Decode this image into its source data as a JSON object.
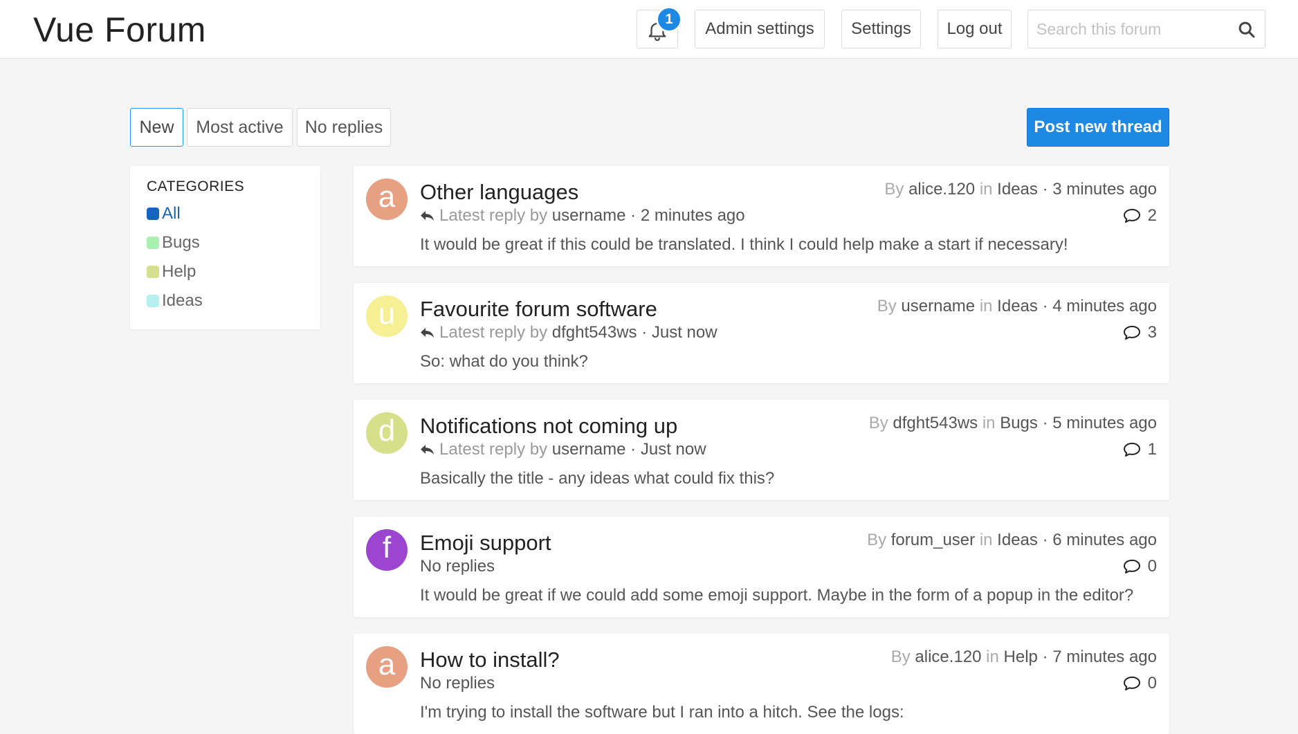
{
  "header": {
    "logo": "Vue Forum",
    "notification_count": "1",
    "admin_label": "Admin settings",
    "settings_label": "Settings",
    "logout_label": "Log out",
    "search_placeholder": "Search this forum"
  },
  "tabs": [
    "New",
    "Most active",
    "No replies"
  ],
  "active_tab": "New",
  "post_button": "Post new thread",
  "categories": {
    "title": "CATEGORIES",
    "items": [
      {
        "label": "All",
        "color": "#1565c0",
        "active": true
      },
      {
        "label": "Bugs",
        "color": "#a8efb0",
        "active": false
      },
      {
        "label": "Help",
        "color": "#d4df8f",
        "active": false
      },
      {
        "label": "Ideas",
        "color": "#b5f0ee",
        "active": false
      }
    ]
  },
  "labels": {
    "by": "By",
    "in": "in",
    "latest_reply_by": "Latest reply by",
    "sep": "·"
  },
  "threads": [
    {
      "avatar_letter": "a",
      "avatar_color": "#e8a083",
      "title": "Other languages",
      "reply_user": "username",
      "reply_time": "2 minutes ago",
      "no_replies": "",
      "snippet": "It would be great if this could be translated. I think I could help make a start if necessary!",
      "author": "alice.120",
      "category": "Ideas",
      "time": "3 minutes ago",
      "count": "2"
    },
    {
      "avatar_letter": "u",
      "avatar_color": "#f7ef94",
      "title": "Favourite forum software",
      "reply_user": "dfght543ws",
      "reply_time": "Just now",
      "no_replies": "",
      "snippet": "So: what do you think?",
      "author": "username",
      "category": "Ideas",
      "time": "4 minutes ago",
      "count": "3"
    },
    {
      "avatar_letter": "d",
      "avatar_color": "#d6e08a",
      "title": "Notifications not coming up",
      "reply_user": "username",
      "reply_time": "Just now",
      "no_replies": "",
      "snippet": "Basically the title - any ideas what could fix this?",
      "author": "dfght543ws",
      "category": "Bugs",
      "time": "5 minutes ago",
      "count": "1"
    },
    {
      "avatar_letter": "f",
      "avatar_color": "#9b45d0",
      "title": "Emoji support",
      "reply_user": "",
      "reply_time": "",
      "no_replies": "No replies",
      "snippet": "It would be great if we could add some emoji support. Maybe in the form of a popup in the editor?",
      "author": "forum_user",
      "category": "Ideas",
      "time": "6 minutes ago",
      "count": "0"
    },
    {
      "avatar_letter": "a",
      "avatar_color": "#e8a083",
      "title": "How to install?",
      "reply_user": "",
      "reply_time": "",
      "no_replies": "No replies",
      "snippet": "I'm trying to install the software but I ran into a hitch. See the logs:",
      "author": "alice.120",
      "category": "Help",
      "time": "7 minutes ago",
      "count": "0"
    }
  ]
}
